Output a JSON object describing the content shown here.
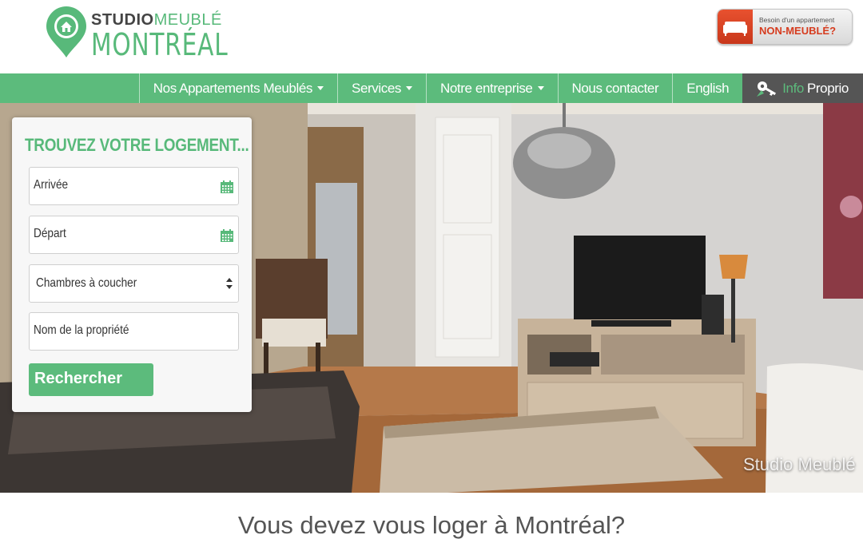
{
  "brand": {
    "studio": "STUDIO",
    "meuble": "MEUBLÉ",
    "montreal": "MONTRÉAL",
    "accent_color": "#5cbb7c"
  },
  "promo": {
    "line1": "Besoin d'un appartement",
    "line2": "NON-MEUBLÉ?",
    "icon": "sofa-icon"
  },
  "nav": {
    "items": [
      {
        "label": "Nos Appartements Meublés",
        "dropdown": true
      },
      {
        "label": "Services",
        "dropdown": true
      },
      {
        "label": "Notre entreprise",
        "dropdown": true
      },
      {
        "label": "Nous contacter",
        "dropdown": false
      },
      {
        "label": "English",
        "dropdown": false
      }
    ],
    "owner": {
      "info": "Info",
      "proprio": "Proprio",
      "icon": "keys-icon"
    }
  },
  "search": {
    "title": "TROUVEZ VOTRE LOGEMENT...",
    "arrival": "Arrivée",
    "departure": "Départ",
    "bedrooms": "Chambres à coucher",
    "property": "Nom de la propriété",
    "button": "Rechercher"
  },
  "hero": {
    "watermark": "Studio Meublé"
  },
  "tagline": "Vous devez vous loger à Montréal?"
}
